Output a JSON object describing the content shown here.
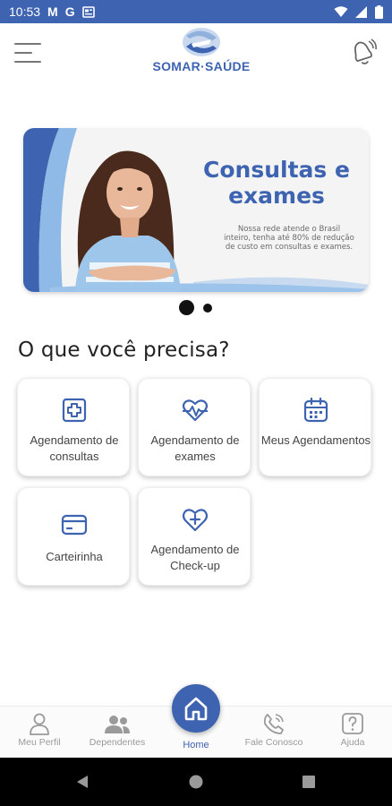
{
  "status_bar": {
    "time": "10:53",
    "glyph_m": "M",
    "glyph_g": "G",
    "icons": [
      "gmail-icon",
      "google-icon",
      "news-icon",
      "wifi-icon",
      "signal-icon",
      "battery-icon"
    ]
  },
  "header": {
    "logo_text": "SOMAR·SAÚDE"
  },
  "banner": {
    "title": "Consultas e exames",
    "text": "Nossa rede atende o Brasil inteiro, tenha até 80% de redução de custo em consultas e exames."
  },
  "section_title": "O que você precisa?",
  "services": [
    {
      "label": "Agendamento de consultas",
      "icon": "medical-plus-icon"
    },
    {
      "label": "Agendamento de exames",
      "icon": "heart-pulse-icon"
    },
    {
      "label": "Meus Agendamentos",
      "icon": "calendar-icon"
    },
    {
      "label": "Carteirinha",
      "icon": "card-icon"
    },
    {
      "label": "Agendamento de Check-up",
      "icon": "heart-plus-icon"
    }
  ],
  "bottom_nav": {
    "profile": "Meu Perfil",
    "dependents": "Dependentes",
    "home": "Home",
    "contact": "Fale Conosco",
    "help": "Ajuda"
  },
  "colors": {
    "brand": "#3e63b0",
    "banner_bg": "#f4f4f4",
    "nav_inactive": "#9a9a9a"
  }
}
